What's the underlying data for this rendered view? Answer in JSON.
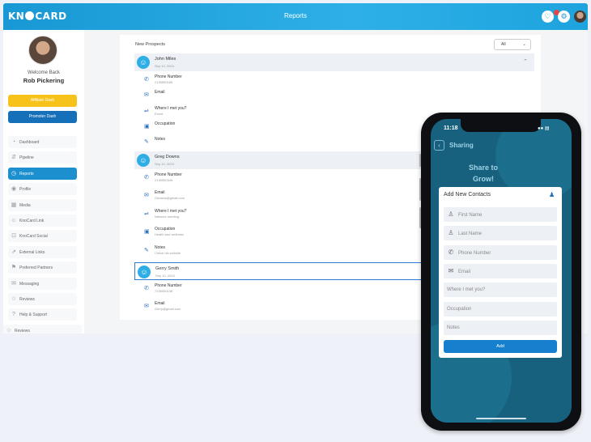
{
  "header": {
    "logo": "KNOCARD",
    "title": "Reports"
  },
  "sidebar": {
    "welcome": "Welcome Back",
    "user_name": "Rob Pickering",
    "affiliate_label": "Affiliate Dash",
    "promoter_label": "Promoter Dash",
    "items": [
      {
        "label": "Dashboard",
        "icon": "dashboard-icon"
      },
      {
        "label": "Pipeline",
        "icon": "pipeline-icon"
      },
      {
        "label": "Reports",
        "icon": "reports-icon"
      },
      {
        "label": "Profile",
        "icon": "profile-icon"
      },
      {
        "label": "Media",
        "icon": "media-icon"
      },
      {
        "label": "KnoCard Link",
        "icon": "link-icon"
      },
      {
        "label": "KnoCard Social",
        "icon": "social-icon"
      },
      {
        "label": "External Links",
        "icon": "external-link-icon"
      },
      {
        "label": "Preferred Partners",
        "icon": "partners-icon"
      },
      {
        "label": "Messaging",
        "icon": "messaging-icon"
      },
      {
        "label": "Reviews",
        "icon": "reviews-icon"
      },
      {
        "label": "Help & Support",
        "icon": "help-icon"
      },
      {
        "label": "Reviews",
        "icon": "reviews-icon"
      }
    ],
    "accent": "#1c8fcf",
    "affiliate_color": "#f7c21a",
    "promoter_color": "#1670b9"
  },
  "main": {
    "section_title": "New Prospects",
    "filter": {
      "selected": "All"
    },
    "prospects": [
      {
        "name": "John Miles",
        "date": "Sep 10, 2024",
        "fields": [
          {
            "label": "Phone Number",
            "value": "2135550185",
            "icon": "phone-icon"
          },
          {
            "label": "Email",
            "value": "",
            "icon": "email-icon"
          },
          {
            "label": "Where I met you?",
            "value": "Event",
            "icon": "handshake-icon"
          },
          {
            "label": "Occupation",
            "value": "",
            "icon": "briefcase-icon"
          },
          {
            "label": "Notes",
            "value": "",
            "icon": "pencil-icon"
          }
        ]
      },
      {
        "name": "Greg Downs",
        "date": "Sep 10, 2024",
        "fields": [
          {
            "label": "Phone Number",
            "value": "2135550349",
            "icon": "phone-icon"
          },
          {
            "label": "Email",
            "value": "Gdowns@gmail.com",
            "icon": "email-icon"
          },
          {
            "label": "Where I met you?",
            "value": "Network meeting",
            "icon": "handshake-icon"
          },
          {
            "label": "Occupation",
            "value": "Health and wellness",
            "icon": "briefcase-icon"
          },
          {
            "label": "Notes",
            "value": "Check his website",
            "icon": "pencil-icon"
          }
        ]
      },
      {
        "name": "Gerry Smith",
        "date": "Sep 10, 2024",
        "fields": [
          {
            "label": "Phone Number",
            "value": "7135550136",
            "icon": "phone-icon"
          },
          {
            "label": "Email",
            "value": "Gerry@gmail.com",
            "icon": "email-icon"
          }
        ]
      }
    ]
  },
  "phone": {
    "time": "11:18",
    "screen_title": "Sharing",
    "hero": "Share to Grow!",
    "modal_title": "Add New Contacts",
    "fields": [
      {
        "placeholder": "First Name",
        "icon": "person-icon"
      },
      {
        "placeholder": "Last Name",
        "icon": "person-icon"
      },
      {
        "placeholder": "Phone Number",
        "icon": "phone-icon"
      },
      {
        "placeholder": "Email",
        "icon": "email-icon"
      },
      {
        "placeholder": "Where I met you?",
        "icon": ""
      },
      {
        "placeholder": "Occupation",
        "icon": ""
      },
      {
        "placeholder": "Notes",
        "icon": ""
      }
    ],
    "add_label": "Add",
    "bg_color": "#17617e"
  }
}
